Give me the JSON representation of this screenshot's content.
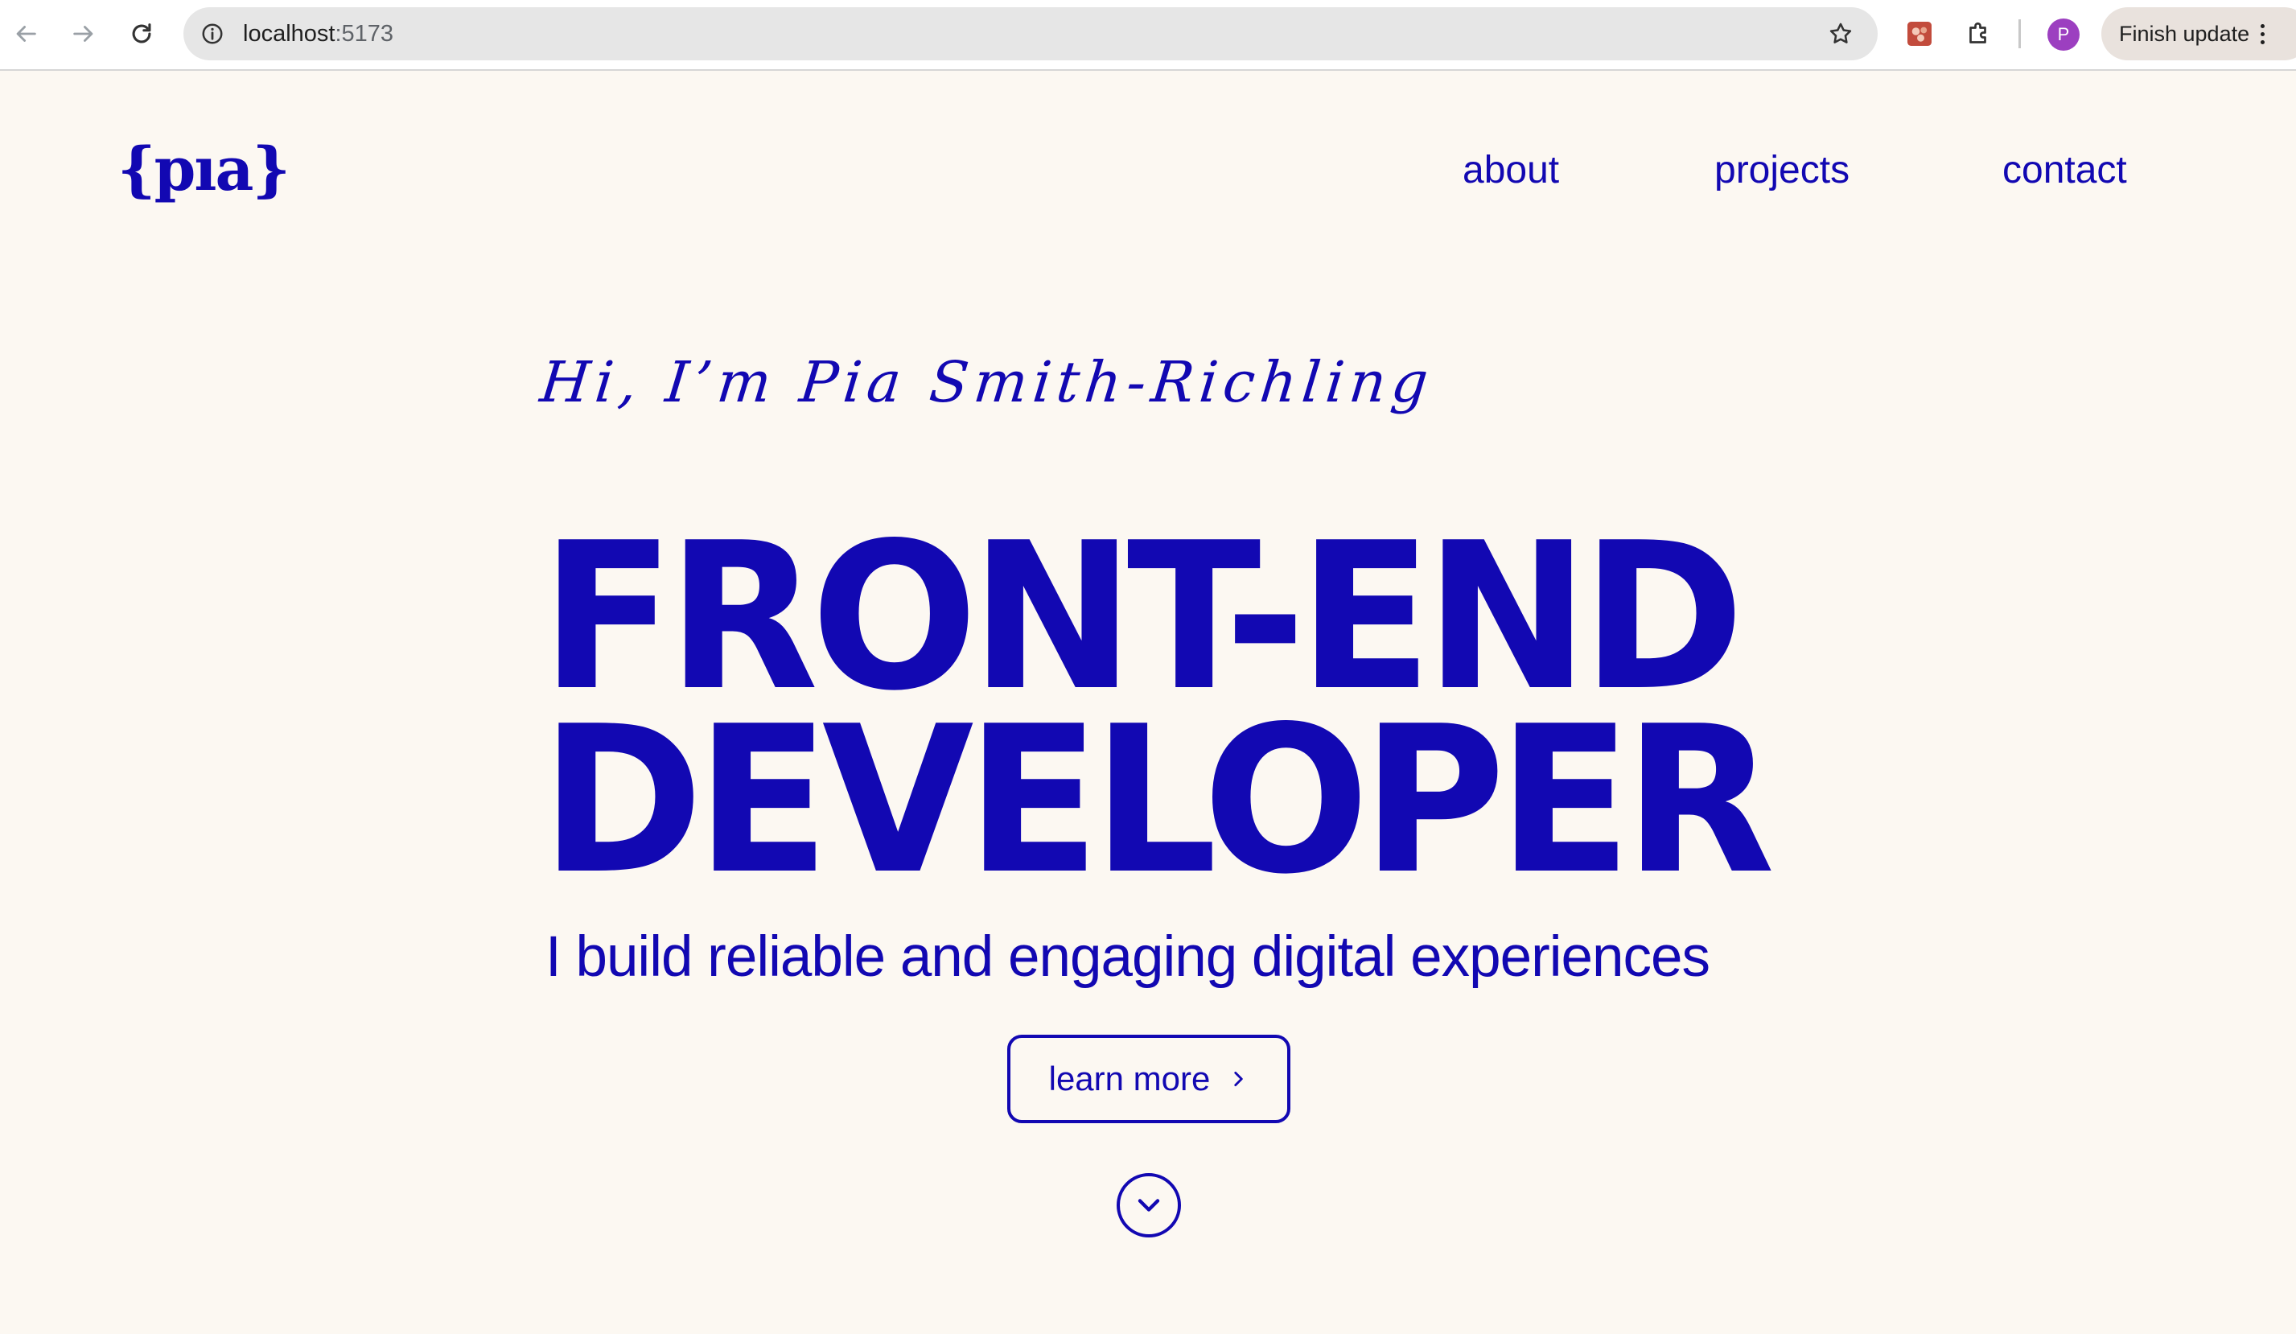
{
  "browser": {
    "url_host": "localhost",
    "url_port": ":5173",
    "profile_initial": "P",
    "finish_update_label": "Finish update",
    "icons": {
      "back": "back-arrow-icon",
      "forward": "forward-arrow-icon",
      "reload": "reload-icon",
      "site_info": "info-icon",
      "bookmark": "star-icon",
      "extension_1": "extension-app-icon",
      "extensions": "puzzle-icon",
      "menu": "kebab-menu-icon"
    }
  },
  "header": {
    "logo_text": "{pıa}",
    "nav": [
      {
        "label": "about"
      },
      {
        "label": "projects"
      },
      {
        "label": "contact"
      }
    ]
  },
  "hero": {
    "greeting": "Hi, I’m Pia Smith-Richling",
    "headline_line1": "FRONT-END",
    "headline_line2": "DEVELOPER",
    "tagline": "I build reliable and engaging digital experiences",
    "cta_label": "learn more",
    "cta_icon": "chevron-right-icon",
    "scroll_icon": "chevron-down-icon"
  },
  "colors": {
    "accent": "#1208B2",
    "background": "#FCF8F2"
  }
}
